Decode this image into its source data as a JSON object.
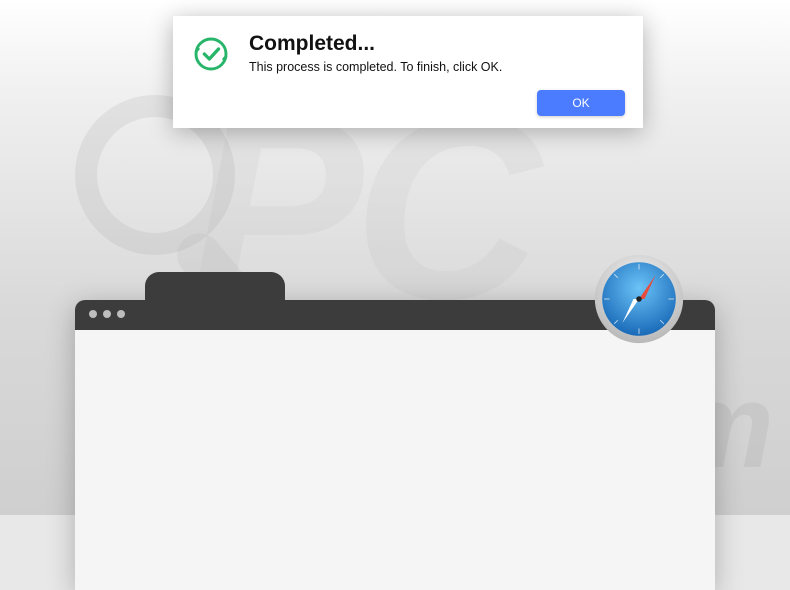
{
  "dialog": {
    "title": "Completed...",
    "message": "This process is completed. To finish, click OK.",
    "ok_label": "OK"
  },
  "watermark": {
    "pc": "PC",
    "risk": "risk.com"
  },
  "icons": {
    "checkmark_color": "#27b56a",
    "safari_blue": "#2a8fd6",
    "safari_needle_red": "#e74c3c"
  }
}
